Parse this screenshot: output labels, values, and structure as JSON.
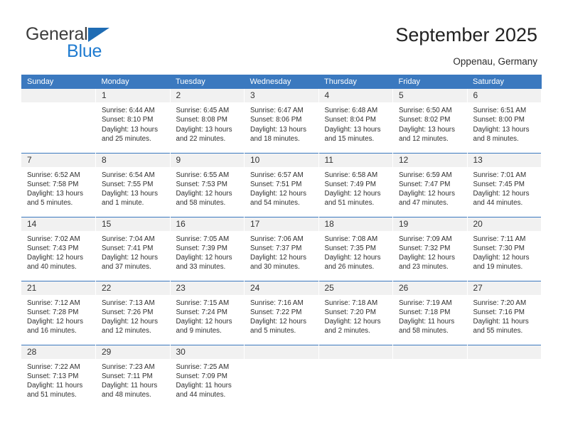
{
  "brand": {
    "name_part1": "General",
    "name_part2": "Blue",
    "triangle_color": "#1f6cb4",
    "blue_color": "#1f7bd0"
  },
  "header": {
    "title": "September 2025",
    "subtitle": "Oppenau, Germany"
  },
  "theme": {
    "header_row_bg": "#3b79bf",
    "header_row_text": "#ffffff",
    "daynum_bg": "#f1f1f1",
    "grid_line": "#3b79bf",
    "cell_bg": "#ffffff",
    "body_text": "#2f2f2f"
  },
  "weekday_headers": [
    "Sunday",
    "Monday",
    "Tuesday",
    "Wednesday",
    "Thursday",
    "Friday",
    "Saturday"
  ],
  "labels": {
    "sunrise_prefix": "Sunrise:",
    "sunset_prefix": "Sunset:",
    "daylight_prefix": "Daylight:"
  },
  "weeks": [
    [
      {
        "day": "",
        "empty": true,
        "line1": "",
        "line2": "",
        "line3": "",
        "line4": ""
      },
      {
        "day": "1",
        "line1": "Sunrise: 6:44 AM",
        "line2": "Sunset: 8:10 PM",
        "line3": "Daylight: 13 hours",
        "line4": "and 25 minutes."
      },
      {
        "day": "2",
        "line1": "Sunrise: 6:45 AM",
        "line2": "Sunset: 8:08 PM",
        "line3": "Daylight: 13 hours",
        "line4": "and 22 minutes."
      },
      {
        "day": "3",
        "line1": "Sunrise: 6:47 AM",
        "line2": "Sunset: 8:06 PM",
        "line3": "Daylight: 13 hours",
        "line4": "and 18 minutes."
      },
      {
        "day": "4",
        "line1": "Sunrise: 6:48 AM",
        "line2": "Sunset: 8:04 PM",
        "line3": "Daylight: 13 hours",
        "line4": "and 15 minutes."
      },
      {
        "day": "5",
        "line1": "Sunrise: 6:50 AM",
        "line2": "Sunset: 8:02 PM",
        "line3": "Daylight: 13 hours",
        "line4": "and 12 minutes."
      },
      {
        "day": "6",
        "line1": "Sunrise: 6:51 AM",
        "line2": "Sunset: 8:00 PM",
        "line3": "Daylight: 13 hours",
        "line4": "and 8 minutes."
      }
    ],
    [
      {
        "day": "7",
        "line1": "Sunrise: 6:52 AM",
        "line2": "Sunset: 7:58 PM",
        "line3": "Daylight: 13 hours",
        "line4": "and 5 minutes."
      },
      {
        "day": "8",
        "line1": "Sunrise: 6:54 AM",
        "line2": "Sunset: 7:55 PM",
        "line3": "Daylight: 13 hours",
        "line4": "and 1 minute."
      },
      {
        "day": "9",
        "line1": "Sunrise: 6:55 AM",
        "line2": "Sunset: 7:53 PM",
        "line3": "Daylight: 12 hours",
        "line4": "and 58 minutes."
      },
      {
        "day": "10",
        "line1": "Sunrise: 6:57 AM",
        "line2": "Sunset: 7:51 PM",
        "line3": "Daylight: 12 hours",
        "line4": "and 54 minutes."
      },
      {
        "day": "11",
        "line1": "Sunrise: 6:58 AM",
        "line2": "Sunset: 7:49 PM",
        "line3": "Daylight: 12 hours",
        "line4": "and 51 minutes."
      },
      {
        "day": "12",
        "line1": "Sunrise: 6:59 AM",
        "line2": "Sunset: 7:47 PM",
        "line3": "Daylight: 12 hours",
        "line4": "and 47 minutes."
      },
      {
        "day": "13",
        "line1": "Sunrise: 7:01 AM",
        "line2": "Sunset: 7:45 PM",
        "line3": "Daylight: 12 hours",
        "line4": "and 44 minutes."
      }
    ],
    [
      {
        "day": "14",
        "line1": "Sunrise: 7:02 AM",
        "line2": "Sunset: 7:43 PM",
        "line3": "Daylight: 12 hours",
        "line4": "and 40 minutes."
      },
      {
        "day": "15",
        "line1": "Sunrise: 7:04 AM",
        "line2": "Sunset: 7:41 PM",
        "line3": "Daylight: 12 hours",
        "line4": "and 37 minutes."
      },
      {
        "day": "16",
        "line1": "Sunrise: 7:05 AM",
        "line2": "Sunset: 7:39 PM",
        "line3": "Daylight: 12 hours",
        "line4": "and 33 minutes."
      },
      {
        "day": "17",
        "line1": "Sunrise: 7:06 AM",
        "line2": "Sunset: 7:37 PM",
        "line3": "Daylight: 12 hours",
        "line4": "and 30 minutes."
      },
      {
        "day": "18",
        "line1": "Sunrise: 7:08 AM",
        "line2": "Sunset: 7:35 PM",
        "line3": "Daylight: 12 hours",
        "line4": "and 26 minutes."
      },
      {
        "day": "19",
        "line1": "Sunrise: 7:09 AM",
        "line2": "Sunset: 7:32 PM",
        "line3": "Daylight: 12 hours",
        "line4": "and 23 minutes."
      },
      {
        "day": "20",
        "line1": "Sunrise: 7:11 AM",
        "line2": "Sunset: 7:30 PM",
        "line3": "Daylight: 12 hours",
        "line4": "and 19 minutes."
      }
    ],
    [
      {
        "day": "21",
        "line1": "Sunrise: 7:12 AM",
        "line2": "Sunset: 7:28 PM",
        "line3": "Daylight: 12 hours",
        "line4": "and 16 minutes."
      },
      {
        "day": "22",
        "line1": "Sunrise: 7:13 AM",
        "line2": "Sunset: 7:26 PM",
        "line3": "Daylight: 12 hours",
        "line4": "and 12 minutes."
      },
      {
        "day": "23",
        "line1": "Sunrise: 7:15 AM",
        "line2": "Sunset: 7:24 PM",
        "line3": "Daylight: 12 hours",
        "line4": "and 9 minutes."
      },
      {
        "day": "24",
        "line1": "Sunrise: 7:16 AM",
        "line2": "Sunset: 7:22 PM",
        "line3": "Daylight: 12 hours",
        "line4": "and 5 minutes."
      },
      {
        "day": "25",
        "line1": "Sunrise: 7:18 AM",
        "line2": "Sunset: 7:20 PM",
        "line3": "Daylight: 12 hours",
        "line4": "and 2 minutes."
      },
      {
        "day": "26",
        "line1": "Sunrise: 7:19 AM",
        "line2": "Sunset: 7:18 PM",
        "line3": "Daylight: 11 hours",
        "line4": "and 58 minutes."
      },
      {
        "day": "27",
        "line1": "Sunrise: 7:20 AM",
        "line2": "Sunset: 7:16 PM",
        "line3": "Daylight: 11 hours",
        "line4": "and 55 minutes."
      }
    ],
    [
      {
        "day": "28",
        "line1": "Sunrise: 7:22 AM",
        "line2": "Sunset: 7:13 PM",
        "line3": "Daylight: 11 hours",
        "line4": "and 51 minutes."
      },
      {
        "day": "29",
        "line1": "Sunrise: 7:23 AM",
        "line2": "Sunset: 7:11 PM",
        "line3": "Daylight: 11 hours",
        "line4": "and 48 minutes."
      },
      {
        "day": "30",
        "line1": "Sunrise: 7:25 AM",
        "line2": "Sunset: 7:09 PM",
        "line3": "Daylight: 11 hours",
        "line4": "and 44 minutes."
      },
      {
        "day": "",
        "empty": true,
        "line1": "",
        "line2": "",
        "line3": "",
        "line4": ""
      },
      {
        "day": "",
        "empty": true,
        "line1": "",
        "line2": "",
        "line3": "",
        "line4": ""
      },
      {
        "day": "",
        "empty": true,
        "line1": "",
        "line2": "",
        "line3": "",
        "line4": ""
      },
      {
        "day": "",
        "empty": true,
        "line1": "",
        "line2": "",
        "line3": "",
        "line4": ""
      }
    ]
  ]
}
